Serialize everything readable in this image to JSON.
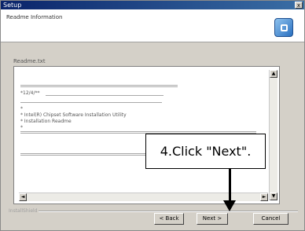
{
  "window": {
    "title": "Setup",
    "close_label": "x"
  },
  "header": {
    "title": "Readme Information"
  },
  "section": {
    "label": "Readme.txt"
  },
  "readme": {
    "code_line": "*12/4/**",
    "lines": [
      "*",
      "* Intel(R) Chipset Software Installation Utility",
      "* Installation Readme",
      "*"
    ]
  },
  "scroll": {
    "up": "▲",
    "down": "▼",
    "left": "◄",
    "right": "►"
  },
  "footer": {
    "brand": "InstallShield"
  },
  "buttons": {
    "back": "< Back",
    "next": "Next >",
    "cancel": "Cancel"
  },
  "callout": {
    "text": "4.Click \"Next\"."
  }
}
